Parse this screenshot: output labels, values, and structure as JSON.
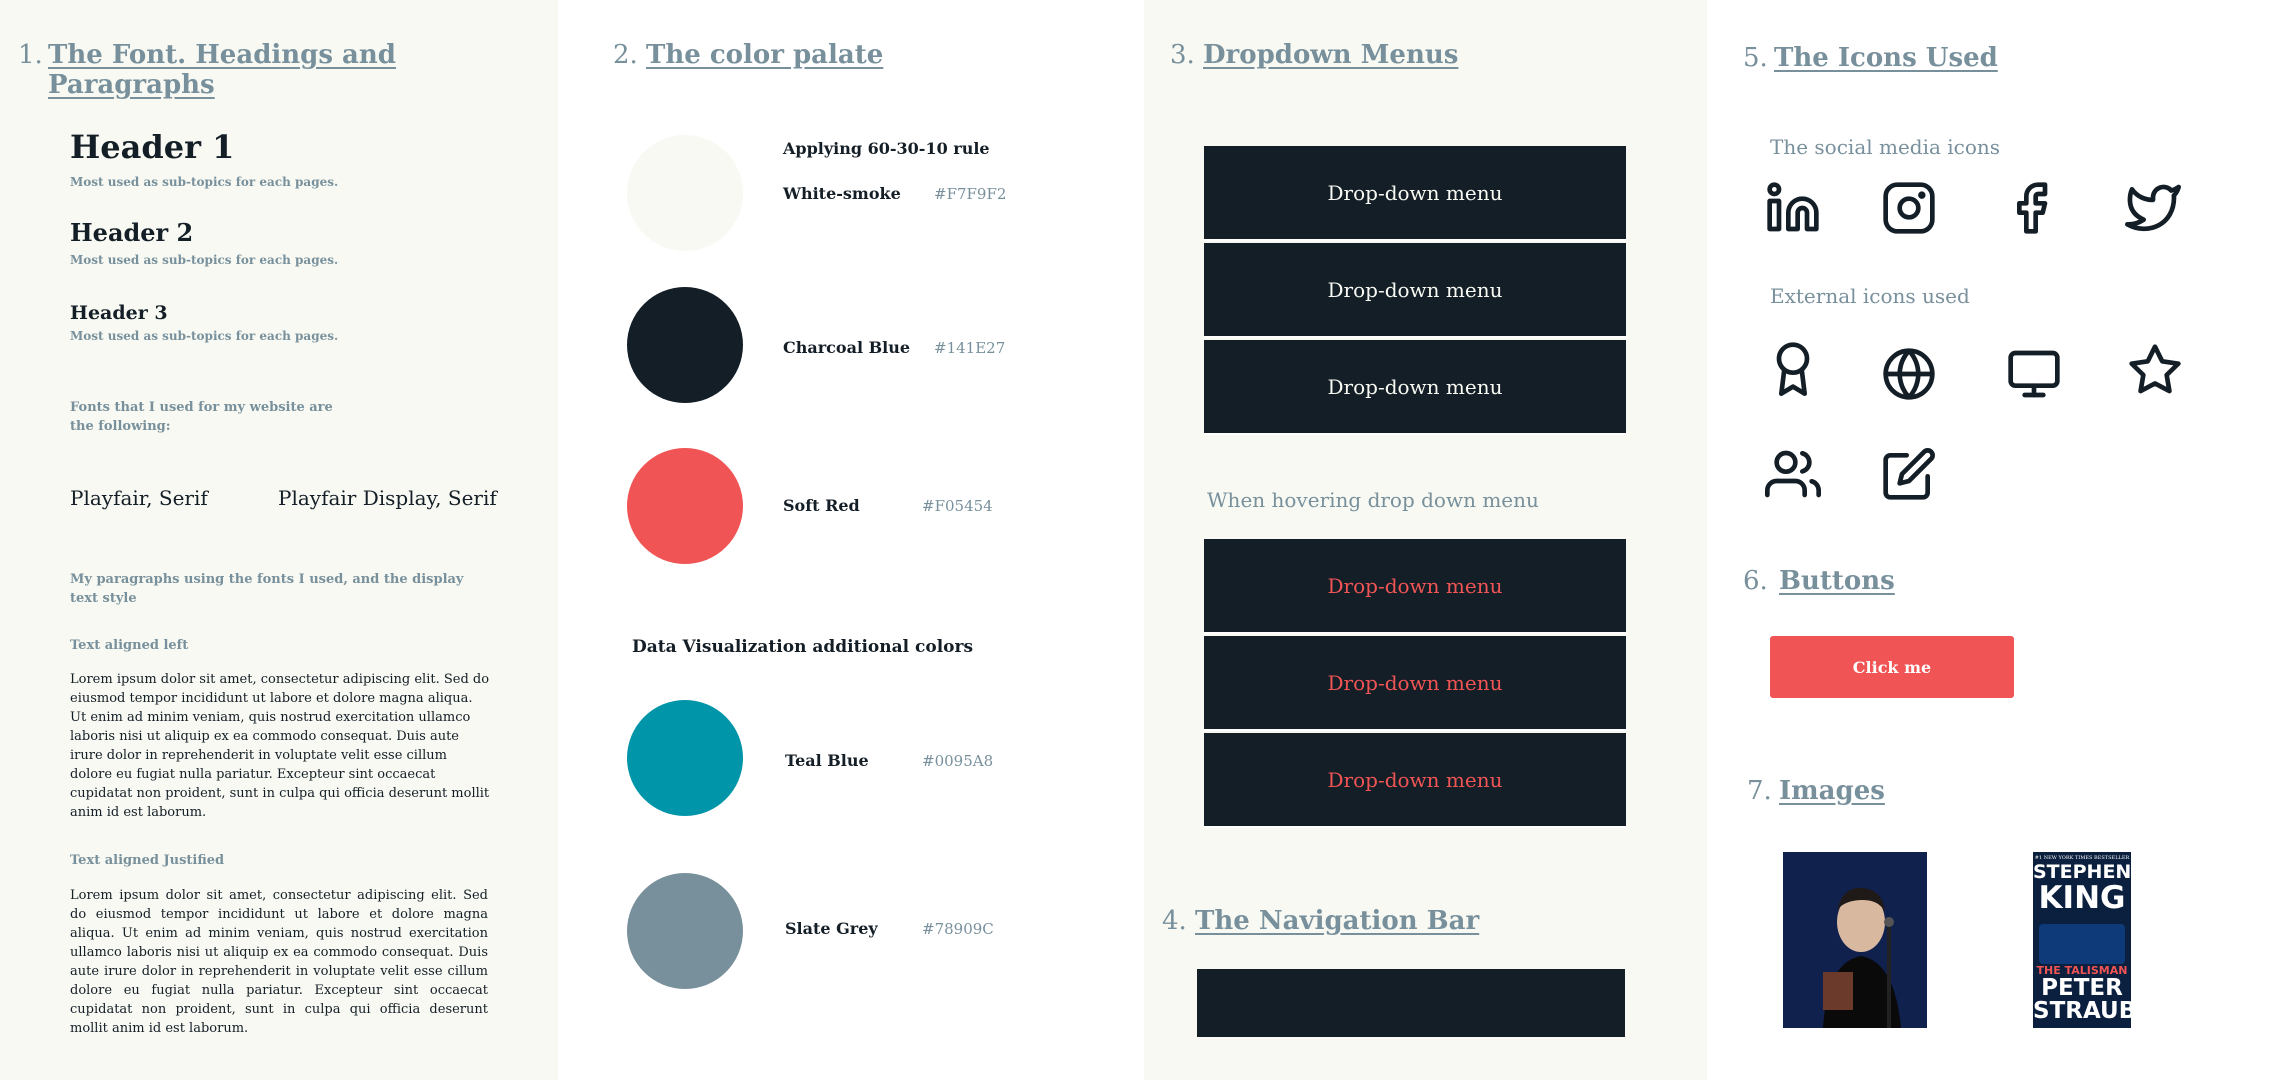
{
  "colors": {
    "white_smoke": "#F7F9F2",
    "charcoal_blue": "#141E27",
    "soft_red": "#F05454",
    "teal_blue": "#0095A8",
    "slate_grey": "#78909C"
  },
  "font_section": {
    "num": "1.",
    "title": "The Font. Headings and Paragraphs",
    "h1": "Header 1",
    "h1_sub": "Most used as sub-topics for each pages.",
    "h2": "Header 2",
    "h2_sub": "Most used as sub-topics for each pages.",
    "h3": "Header 3",
    "h3_sub": "Most used as sub-topics for each pages.",
    "fonts_intro": "Fonts that I used for my website are the following:",
    "font_a": "Playfair, Serif",
    "font_b": "Playfair Display, Serif",
    "para_intro": "My paragraphs using the fonts I used, and the display text style",
    "left_label": "Text aligned left",
    "left_text": "Lorem ipsum dolor sit amet, consectetur adipiscing elit. Sed do eiusmod tempor incididunt ut labore et dolore magna aliqua. Ut enim ad minim veniam, quis nostrud exercitation ullamco laboris nisi ut aliquip ex ea commodo consequat. Duis aute irure dolor in reprehenderit in voluptate velit esse cillum dolore eu fugiat nulla pariatur. Excepteur sint occaecat cupidatat non proident, sunt in culpa qui officia deserunt mollit anim id est laborum.",
    "justified_label": "Text aligned Justified",
    "justified_text": "Lorem ipsum dolor sit amet, consectetur adipiscing elit. Sed do eiusmod tempor incididunt ut labore et dolore magna aliqua. Ut enim ad minim veniam, quis nostrud exercitation ullamco laboris nisi ut aliquip ex ea commodo consequat. Duis aute irure dolor in reprehenderit in voluptate velit esse cillum dolore eu fugiat nulla pariatur. Excepteur sint occaecat cupidatat non proident, sunt in culpa qui officia deserunt mollit anim id est laborum."
  },
  "color_section": {
    "num": "2.",
    "title": "The color palate",
    "rule": "Applying 60-30-10 rule",
    "primary": [
      {
        "name": "White-smoke",
        "hex": "#F7F9F2"
      },
      {
        "name": "Charcoal Blue",
        "hex": "#141E27"
      },
      {
        "name": "Soft Red",
        "hex": "#F05454"
      }
    ],
    "dataviz_title": "Data Visualization additional colors",
    "dataviz": [
      {
        "name": "Teal Blue",
        "hex": "#0095A8"
      },
      {
        "name": "Slate Grey",
        "hex": "#78909C"
      }
    ]
  },
  "dropdown_section": {
    "num": "3.",
    "title": "Dropdown Menus",
    "items": [
      "Drop-down menu",
      "Drop-down menu",
      "Drop-down menu"
    ],
    "hover_label": "When hovering drop down menu",
    "hover_items": [
      "Drop-down menu",
      "Drop-down menu",
      "Drop-down menu"
    ]
  },
  "nav_section": {
    "num": "4.",
    "title": "The Navigation Bar"
  },
  "icons_section": {
    "num": "5.",
    "title": "The Icons Used",
    "social_label": "The social media icons",
    "social_icons": [
      "linkedin-icon",
      "instagram-icon",
      "facebook-icon",
      "twitter-icon"
    ],
    "external_label": "External icons used",
    "external_icons": [
      "award-icon",
      "globe-icon",
      "monitor-icon",
      "star-icon",
      "users-icon",
      "edit-icon"
    ]
  },
  "buttons_section": {
    "num": "6.",
    "title": "Buttons",
    "button_label": "Click me"
  },
  "images_section": {
    "num": "7.",
    "title": "Images",
    "book_cover": {
      "top": "#1 NEW YORK TIMES BESTSELLER",
      "author1a": "STEPHEN",
      "author1b": "KING",
      "book_title": "THE TALISMAN",
      "author2a": "PETER",
      "author2b": "STRAUB"
    }
  }
}
